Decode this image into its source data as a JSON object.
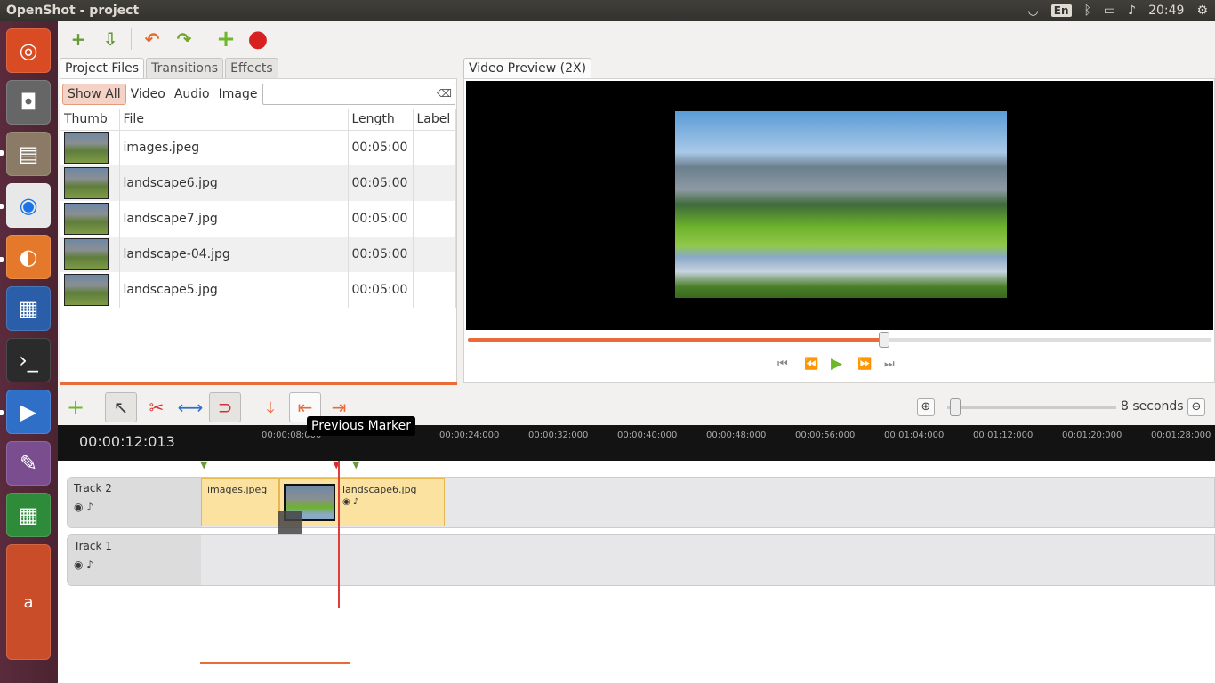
{
  "window": {
    "title": "OpenShot - project"
  },
  "tray": {
    "lang": "En",
    "clock": "20:49"
  },
  "toolbar": {
    "new": "+",
    "import": "⇩",
    "undo": "↶",
    "redo": "↷",
    "add": "+",
    "record": "●"
  },
  "tabs": [
    "Project Files",
    "Transitions",
    "Effects"
  ],
  "filters": {
    "show_all": "Show All",
    "video": "Video",
    "audio": "Audio",
    "image": "Image",
    "search_placeholder": ""
  },
  "columns": [
    "Thumb",
    "File",
    "Length",
    "Label"
  ],
  "files": [
    {
      "name": "images.jpeg",
      "length": "00:05:00",
      "label": ""
    },
    {
      "name": "landscape6.jpg",
      "length": "00:05:00",
      "label": ""
    },
    {
      "name": "landscape7.jpg",
      "length": "00:05:00",
      "label": ""
    },
    {
      "name": "landscape-04.jpg",
      "length": "00:05:00",
      "label": ""
    },
    {
      "name": "landscape5.jpg",
      "length": "00:05:00",
      "label": ""
    }
  ],
  "preview": {
    "tab": "Video Preview (2X)",
    "progress": 0.56
  },
  "player": {
    "jump_start": "⏮",
    "rewind": "⏪",
    "play": "▶",
    "forward": "⏩",
    "jump_end": "⏭"
  },
  "timeline": {
    "zoom_label": "8 seconds",
    "tooltip": "Previous Marker",
    "current_time": "00:00:12:013",
    "ticks": [
      "00:00:08:000",
      "00:00:24:000",
      "00:00:32:000",
      "00:00:40:000",
      "00:00:48:000",
      "00:00:56:000",
      "00:01:04:000",
      "00:01:12:000",
      "00:01:20:000",
      "00:01:28:000"
    ],
    "tracks": [
      {
        "name": "Track 2",
        "clips": [
          "images.jpeg",
          "landscape6.jpg"
        ]
      },
      {
        "name": "Track 1",
        "clips": []
      }
    ]
  },
  "colors": {
    "accent": "#e96b3a",
    "playhead": "#e23b3b",
    "clip": "#fbe2a0"
  }
}
